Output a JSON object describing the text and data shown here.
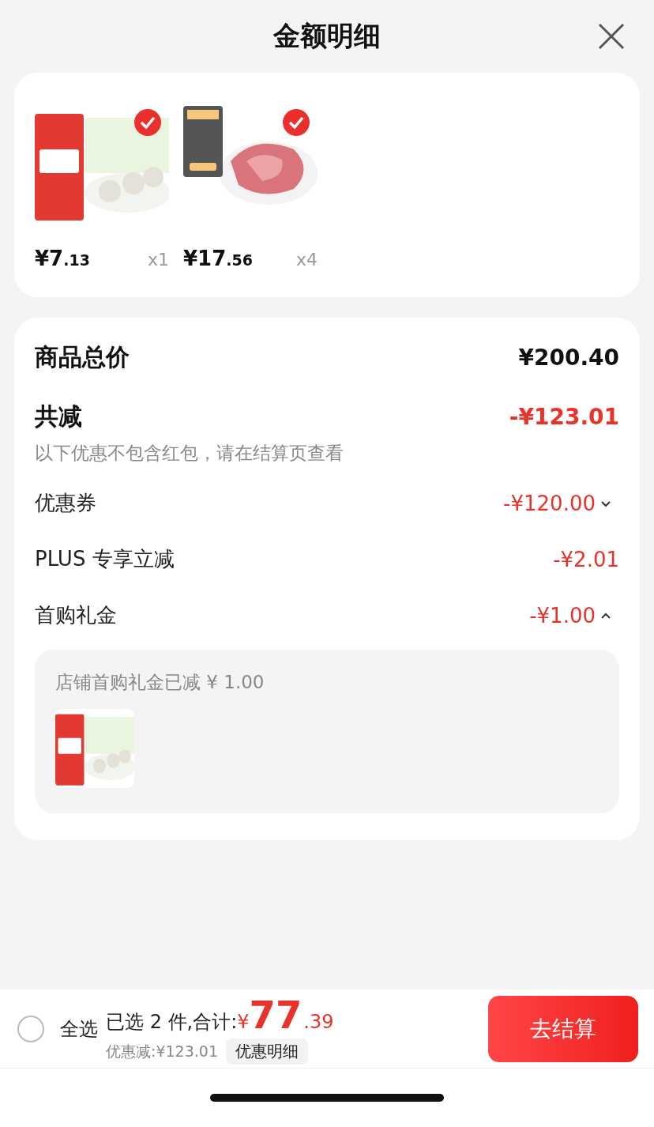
{
  "header": {
    "title": "金额明细"
  },
  "products": [
    {
      "kind": "picture",
      "checked": true,
      "price_main": "¥7",
      "price_decimal": ".13",
      "quantity": "x1"
    },
    {
      "kind": "picture",
      "checked": true,
      "price_main": "¥17",
      "price_decimal": ".56",
      "quantity": "x4"
    }
  ],
  "summary": {
    "total_label": "商品总价",
    "total_value": "¥200.40",
    "reduction_label": "共减",
    "reduction_value": "-¥123.01",
    "note": "以下优惠不包含红包，请在结算页查看",
    "discounts": [
      {
        "kind": "expandable",
        "label": "优惠券",
        "value": "-¥120.00",
        "expanded": false
      },
      {
        "kind": "plain",
        "label": "PLUS 专享立减",
        "value": "-¥2.01"
      },
      {
        "kind": "expandable",
        "label": "首购礼金",
        "value": "-¥1.00",
        "expanded": true,
        "detail": {
          "text": "店铺首购礼金已减 ¥ 1.00"
        }
      }
    ]
  },
  "footer": {
    "select_all_checked": false,
    "select_all_label": "全选",
    "selected_text": "已选 2 件,合计:",
    "currency": "¥",
    "total_main": "77",
    "total_decimal": ".39",
    "discount_text": "优惠减:¥123.01",
    "detail_button": "优惠明细",
    "checkout_button": "去结算"
  }
}
